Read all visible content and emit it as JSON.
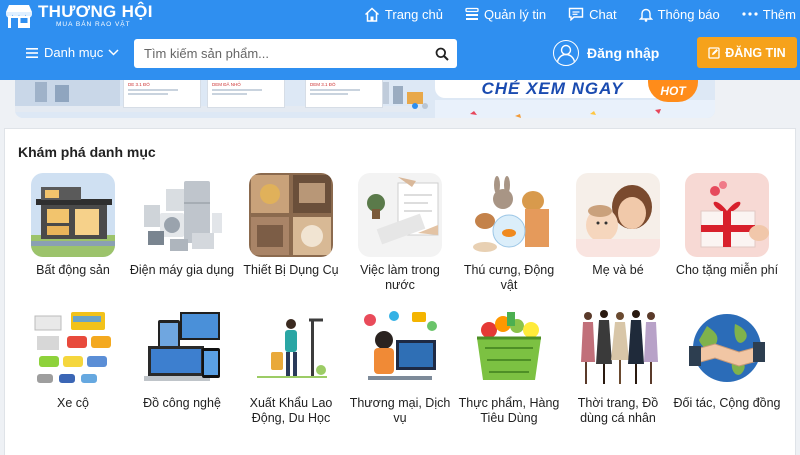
{
  "header": {
    "logo_title": "THƯƠNG HỘI",
    "logo_subtitle": "MUA BÁN RAO VẶT",
    "nav": [
      {
        "label": "Trang chủ",
        "icon": "home-icon"
      },
      {
        "label": "Quản lý tin",
        "icon": "list-icon"
      },
      {
        "label": "Chat",
        "icon": "chat-icon"
      },
      {
        "label": "Thông báo",
        "icon": "bell-icon"
      },
      {
        "label": "Thêm",
        "icon": "more-icon"
      }
    ],
    "category_menu": "Danh mục",
    "search_placeholder": "Tìm kiếm sản phẩm...",
    "login_label": "Đăng nhập",
    "post_button": "ĐĂNG TIN"
  },
  "banner": {
    "cta": "CHẺ XEM NGAY",
    "badge": "HOT"
  },
  "categories": {
    "title": "Khám phá danh mục",
    "items": [
      {
        "label": "Bất động sản"
      },
      {
        "label": "Điện máy gia dụng"
      },
      {
        "label": "Thiết Bị Dụng Cụ"
      },
      {
        "label": "Việc làm trong nước"
      },
      {
        "label": "Thú cưng, Động vật"
      },
      {
        "label": "Mẹ và bé"
      },
      {
        "label": "Cho tặng miễn phí"
      },
      {
        "label": "Xe cộ"
      },
      {
        "label": "Đồ công nghệ"
      },
      {
        "label": "Xuất Khẩu Lao Động, Du Học"
      },
      {
        "label": "Thương mại, Dịch vụ"
      },
      {
        "label": "Thực phẩm, Hàng Tiêu Dùng"
      },
      {
        "label": "Thời trang, Đồ dùng cá nhân"
      },
      {
        "label": "Đối tác, Cộng đồng"
      }
    ]
  },
  "colors": {
    "header_blue": "#2f8ff0",
    "post_orange": "#f6a21b",
    "page_bg": "#eef1f5"
  }
}
